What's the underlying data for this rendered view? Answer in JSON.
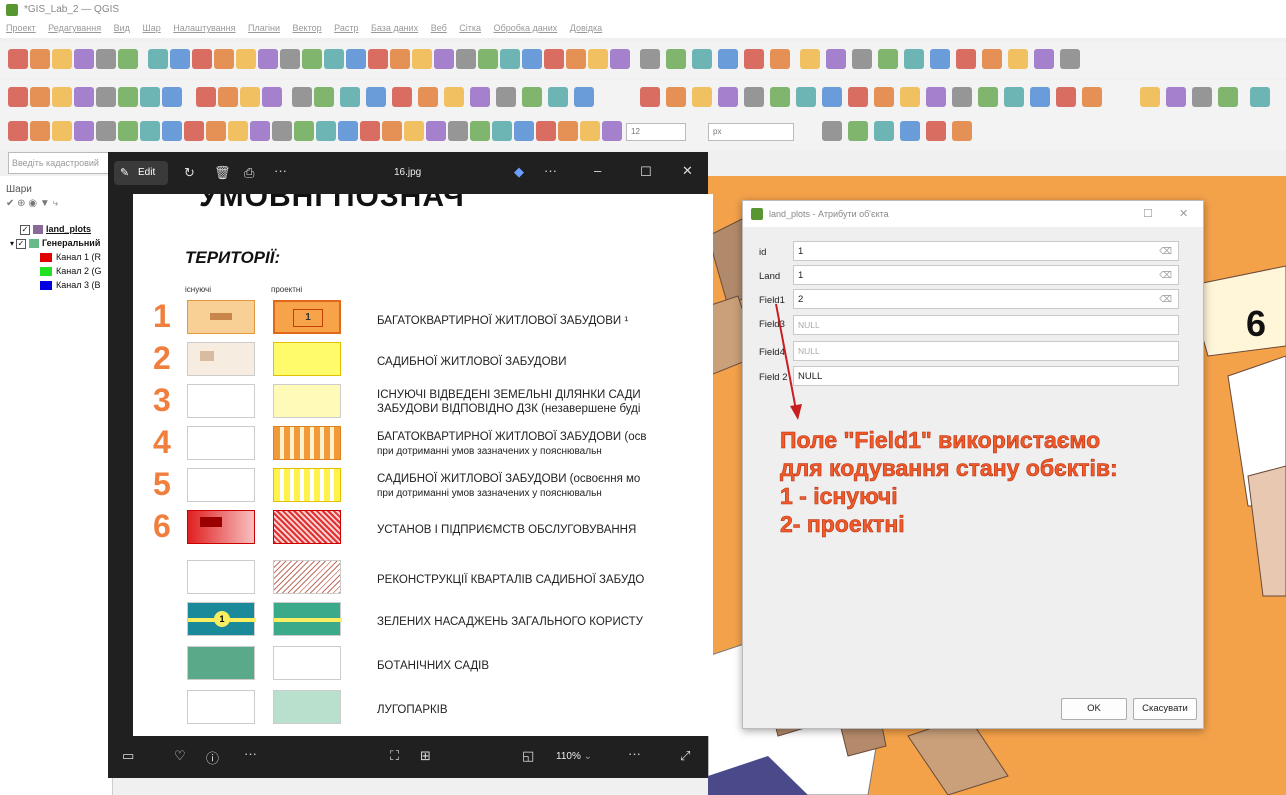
{
  "qgis": {
    "title": "*GIS_Lab_2 — QGIS",
    "menu": [
      "Проект",
      "Редагування",
      "Вид",
      "Шар",
      "Налаштування",
      "Плагіни",
      "Вектор",
      "Растр",
      "База даних",
      "Веб",
      "Сітка",
      "Обробка даних",
      "Довідка"
    ],
    "search_placeholder": "Введіть кадастровий",
    "layers_title": "Шари",
    "layers": [
      {
        "label": "land_plots",
        "checked": true,
        "bold": true
      },
      {
        "label": "Генеральний",
        "checked": true,
        "bold": true
      }
    ],
    "bands": [
      {
        "label": "Канал 1 (R",
        "color": "#e00000"
      },
      {
        "label": "Канал 2 (G",
        "color": "#22e022"
      },
      {
        "label": "Канал 3 (B",
        "color": "#0000e0"
      }
    ],
    "font_size_value": "12",
    "unit_value": "px",
    "map_number": "6"
  },
  "viewer": {
    "filename": "16.jpg",
    "edit_label": "Edit",
    "zoom": "110%",
    "heading": "УМОВНІ ПОЗНАЧ",
    "territories_label": "ТЕРИТОРІЇ:",
    "col_existing": "існуючі",
    "col_projected": "проектні",
    "rows": [
      {
        "num": "1",
        "text": "БАГАТОКВАРТИРНОЇ ЖИТЛОВОЇ ЗАБУДОВИ ¹",
        "text2": ""
      },
      {
        "num": "2",
        "text": "САДИБНОЇ ЖИТЛОВОЇ ЗАБУДОВИ",
        "text2": ""
      },
      {
        "num": "3",
        "text": "ІСНУЮЧІ ВІДВЕДЕНІ ЗЕМЕЛЬНІ ДІЛЯНКИ САДИ",
        "text2": "ЗАБУДОВИ ВІДПОВІДНО ДЗК (незавершене буді"
      },
      {
        "num": "4",
        "text": "БАГАТОКВАРТИРНОЇ ЖИТЛОВОЇ ЗАБУДОВИ (осв",
        "text2": "при дотриманні умов зазначених у пояснювальн"
      },
      {
        "num": "5",
        "text": "САДИБНОЇ ЖИТЛОВОЇ ЗАБУДОВИ (освоєння мо",
        "text2": "при дотриманні умов зазначених у пояснювальн"
      },
      {
        "num": "6",
        "text": "УСТАНОВ І ПІДПРИЄМСТВ ОБСЛУГОВУВАННЯ",
        "text2": ""
      },
      {
        "num": "",
        "text": "РЕКОНСТРУКЦІЇ КВАРТАЛІВ САДИБНОЇ ЗАБУДО",
        "text2": ""
      },
      {
        "num": "",
        "text": "ЗЕЛЕНИХ НАСАДЖЕНЬ ЗАГАЛЬНОГО КОРИСТУ",
        "text2": ""
      },
      {
        "num": "",
        "text": "БОТАНІЧНИХ САДІВ",
        "text2": ""
      },
      {
        "num": "",
        "text": "ЛУГОПАРКІВ",
        "text2": ""
      }
    ]
  },
  "dialog": {
    "title": "land_plots - Атрибути об'єкта",
    "fields": [
      {
        "label": "id",
        "value": "1",
        "null": false
      },
      {
        "label": "Land",
        "value": "1",
        "null": false
      },
      {
        "label": "Field1",
        "value": "2",
        "null": false
      },
      {
        "label": "Field3",
        "value": "NULL",
        "null": true
      },
      {
        "label": "Field4",
        "value": "NULL",
        "null": true
      },
      {
        "label": "Field 2",
        "value": "NULL",
        "null": true
      }
    ],
    "ok_label": "OK",
    "cancel_label": "Скасувати"
  },
  "annotation": {
    "line1": "Поле \"Field1\" використаємо",
    "line2": "для кодування стану обєктів:",
    "line3": "1 - існуючі",
    "line4": "2- проектні"
  },
  "colors": {
    "annotation": "#f15a29",
    "map_orange": "#f4a24a",
    "qgis_green": "#589632"
  }
}
